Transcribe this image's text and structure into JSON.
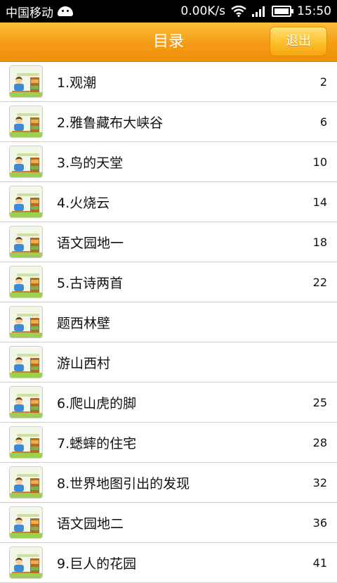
{
  "status": {
    "carrier": "中国移动",
    "speed": "0.00K/s",
    "time": "15:50"
  },
  "header": {
    "title": "目录",
    "exit_label": "退出"
  },
  "thumbnail_icon": "textbook-cover-icon",
  "items": [
    {
      "label": "1.观潮",
      "page": "2"
    },
    {
      "label": "2.雅鲁藏布大峡谷",
      "page": "6"
    },
    {
      "label": "3.鸟的天堂",
      "page": "10"
    },
    {
      "label": "4.火烧云",
      "page": "14"
    },
    {
      "label": "语文园地一",
      "page": "18"
    },
    {
      "label": "5.古诗两首",
      "page": "22"
    },
    {
      "label": "题西林壁",
      "page": ""
    },
    {
      "label": "游山西村",
      "page": ""
    },
    {
      "label": "6.爬山虎的脚",
      "page": "25"
    },
    {
      "label": "7.蟋蟀的住宅",
      "page": "28"
    },
    {
      "label": "8.世界地图引出的发现",
      "page": "32"
    },
    {
      "label": "语文园地二",
      "page": "36"
    },
    {
      "label": "9.巨人的花园",
      "page": "41"
    }
  ]
}
